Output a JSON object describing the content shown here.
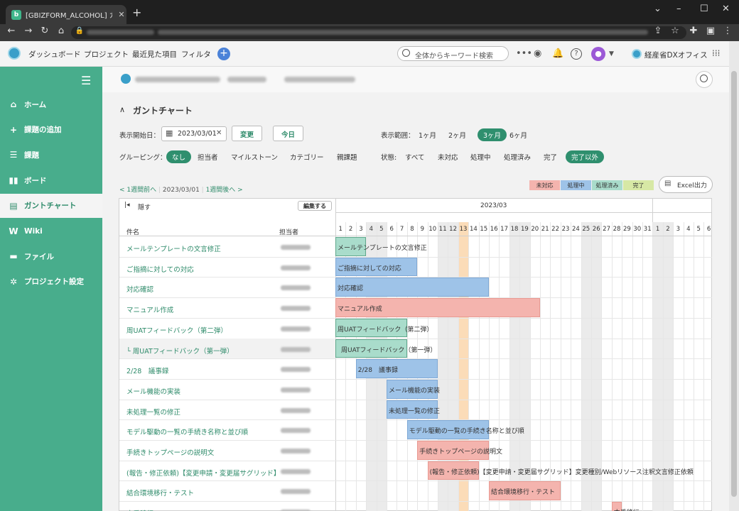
{
  "browser": {
    "tab_title": "[GBIZFORM_ALCOHOL] ガントチャー",
    "favicon_letter": "b",
    "new_tab": "+",
    "tab_close": "✕"
  },
  "appnav": {
    "items": [
      "ダッシュボード",
      "プロジェクト",
      "最近見た項目",
      "フィルタ"
    ],
    "search_placeholder": "全体からキーワード検索",
    "org_name": "経産省DXオフィス",
    "avatar_icon": "user-icon"
  },
  "sidebar": {
    "items": [
      {
        "label": "ホーム",
        "icon": "home-icon"
      },
      {
        "label": "課題の追加",
        "icon": "plus-icon"
      },
      {
        "label": "課題",
        "icon": "list-icon"
      },
      {
        "label": "ボード",
        "icon": "board-icon"
      },
      {
        "label": "ガントチャート",
        "icon": "gantt-icon"
      },
      {
        "label": "Wiki",
        "icon": "wiki-icon"
      },
      {
        "label": "ファイル",
        "icon": "file-icon"
      },
      {
        "label": "プロジェクト設定",
        "icon": "gear-icon"
      }
    ],
    "active_index": 4
  },
  "gantt": {
    "section_title": "ガントチャート",
    "start_label": "表示開始日：",
    "start_date": "2023/03/01",
    "change_button": "変更",
    "today_button": "今日",
    "range_label": "表示範囲：",
    "range_options": [
      "1ヶ月",
      "2ヶ月",
      "3ヶ月",
      "6ヶ月"
    ],
    "range_selected": "3ヶ月",
    "grouping_label": "グルーピング：",
    "grouping_options": [
      "なし",
      "担当者",
      "マイルストーン",
      "カテゴリー",
      "親課題"
    ],
    "grouping_selected": "なし",
    "status_label": "状態:",
    "status_options": [
      "すべて",
      "未対応",
      "処理中",
      "処理済み",
      "完了",
      "完了以外"
    ],
    "status_selected": "完了以外",
    "legend": [
      {
        "label": "未対応",
        "color": "#f4b4ae"
      },
      {
        "label": "処理中",
        "color": "#9ec3e8"
      },
      {
        "label": "処理済み",
        "color": "#a9dccb"
      },
      {
        "label": "完了",
        "color": "#d7e8a5"
      }
    ],
    "excel_button": "Excel出力",
    "prev_week": "< 1週間前へ",
    "current_date": "2023/03/01",
    "next_week": "1週間後へ >",
    "hide_label": "隠す",
    "edit_button": "編集する",
    "month_label": "2023/03",
    "col_subject": "件名",
    "col_assignee": "担当者",
    "days": [
      "1",
      "2",
      "3",
      "4",
      "5",
      "6",
      "7",
      "8",
      "9",
      "10",
      "11",
      "12",
      "13",
      "14",
      "15",
      "16",
      "17",
      "18",
      "19",
      "20",
      "21",
      "22",
      "23",
      "24",
      "25",
      "26",
      "27",
      "28",
      "29",
      "30",
      "31",
      "1",
      "2",
      "3",
      "4",
      "5",
      "6"
    ],
    "today_day_index": 12,
    "tasks": [
      {
        "name": "メールテンプレートの文言修正",
        "bar_label": "メールテンプレートの文言修正",
        "start": 0,
        "end": 2,
        "status": "処理済み"
      },
      {
        "name": "ご指摘に対しての対応",
        "bar_label": "ご指摘に対しての対応",
        "start": 0,
        "end": 7,
        "status": "処理中"
      },
      {
        "name": "対応確認",
        "bar_label": "対応確認",
        "start": 0,
        "end": 14,
        "status": "処理中"
      },
      {
        "name": "マニュアル作成",
        "bar_label": "マニュアル作成",
        "start": 0,
        "end": 19,
        "status": "未対応"
      },
      {
        "name": "周UATフィードバック（第二弾）",
        "bar_label": "周UATフィードバック（第二弾）",
        "start": 0,
        "end": 6,
        "status": "処理済み"
      },
      {
        "name": "└ 周UATフィードバック（第一弾）",
        "bar_label": "周UATフィードバック（第一弾）",
        "start": 0,
        "end": 6,
        "status": "処理済み"
      },
      {
        "name": "2/28　議事録",
        "bar_label": "2/28　議事録",
        "start": 2,
        "end": 9,
        "status": "処理中"
      },
      {
        "name": "メール機能の実装",
        "bar_label": "メール機能の実装",
        "start": 5,
        "end": 9,
        "status": "処理中"
      },
      {
        "name": "未処理一覧の修正",
        "bar_label": "未処理一覧の修正",
        "start": 5,
        "end": 9,
        "status": "処理中"
      },
      {
        "name": "モデル駆動の一覧の手続き名称と並び順",
        "bar_label": "モデル駆動の一覧の手続き名称と並び順",
        "start": 7,
        "end": 14,
        "status": "処理中"
      },
      {
        "name": "手続きトップページの説明文",
        "bar_label": "手続きトップページの説明文",
        "start": 8,
        "end": 14,
        "status": "未対応"
      },
      {
        "name": "(報告・修正依頼)【変更申請・変更届サグリッド】...",
        "bar_label": "(報告・修正依頼)【変更申請・変更届サグリッド】変更種別/Webリソース注釈文言修正依頼",
        "start": 9,
        "end": 13,
        "status": "未対応"
      },
      {
        "name": "結合環境移行・テスト",
        "bar_label": "結合環境移行・テスト",
        "start": 15,
        "end": 21,
        "status": "未対応"
      },
      {
        "name": "本番移行",
        "bar_label": "本番移行",
        "start": 27,
        "end": 27,
        "status": "未対応"
      }
    ]
  }
}
